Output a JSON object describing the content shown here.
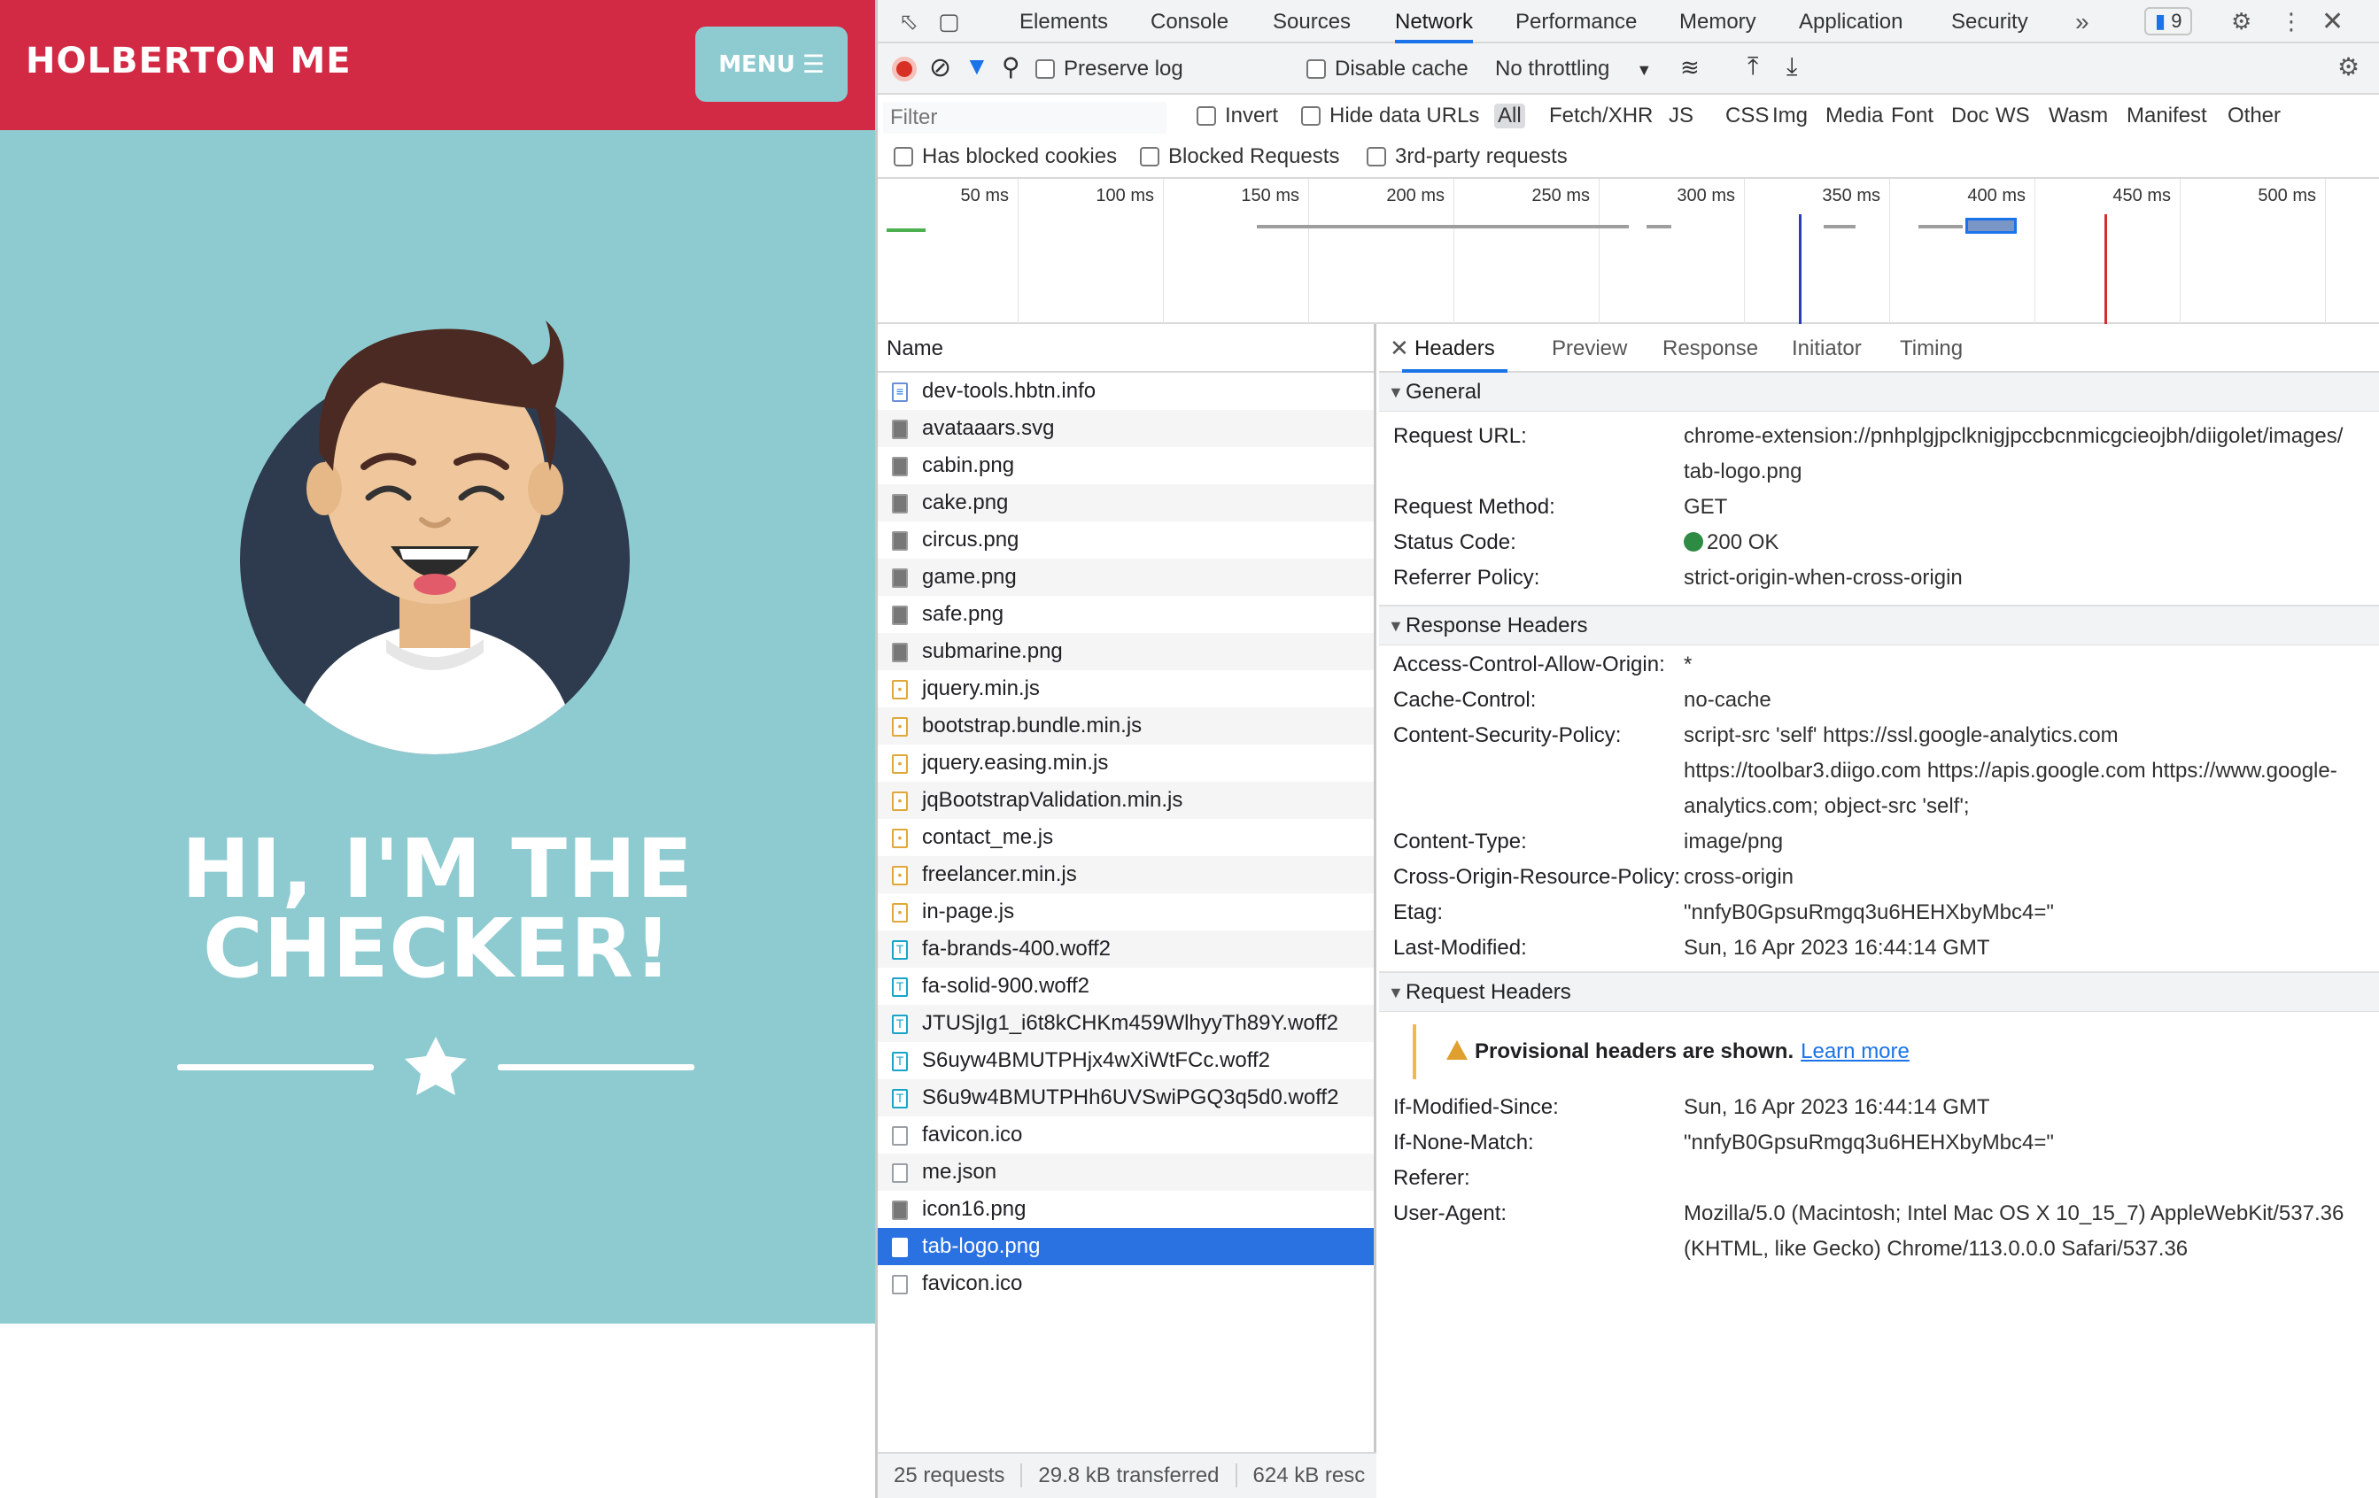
{
  "site": {
    "brand": "HOLBERTON ME",
    "menu_label": "MENU",
    "hero_title_line1": "HI, I'M THE",
    "hero_title_line2": "CHECKER!",
    "colors": {
      "nav": "#d22a44",
      "hero": "#8ecbd1"
    }
  },
  "devtools": {
    "tabs": [
      "Elements",
      "Console",
      "Sources",
      "Network",
      "Performance",
      "Memory",
      "Application",
      "Security"
    ],
    "active_tab": "Network",
    "issues_count": "9",
    "toolbar": {
      "preserve_log": "Preserve log",
      "disable_cache": "Disable cache",
      "throttling": "No throttling"
    },
    "filter": {
      "placeholder": "Filter",
      "invert": "Invert",
      "hide_data_urls": "Hide data URLs",
      "types": [
        "All",
        "Fetch/XHR",
        "JS",
        "CSS",
        "Img",
        "Media",
        "Font",
        "Doc",
        "WS",
        "Wasm",
        "Manifest",
        "Other"
      ],
      "has_blocked_cookies": "Has blocked cookies",
      "blocked_requests": "Blocked Requests",
      "third_party": "3rd-party requests"
    },
    "timeline_ticks": [
      "50 ms",
      "100 ms",
      "150 ms",
      "200 ms",
      "250 ms",
      "300 ms",
      "350 ms",
      "400 ms",
      "450 ms",
      "500 ms"
    ],
    "list_header": "Name",
    "requests": [
      {
        "name": "dev-tools.hbtn.info",
        "type": "doc"
      },
      {
        "name": "avataaars.svg",
        "type": "img"
      },
      {
        "name": "cabin.png",
        "type": "img"
      },
      {
        "name": "cake.png",
        "type": "img"
      },
      {
        "name": "circus.png",
        "type": "img"
      },
      {
        "name": "game.png",
        "type": "img"
      },
      {
        "name": "safe.png",
        "type": "img"
      },
      {
        "name": "submarine.png",
        "type": "img"
      },
      {
        "name": "jquery.min.js",
        "type": "js"
      },
      {
        "name": "bootstrap.bundle.min.js",
        "type": "js"
      },
      {
        "name": "jquery.easing.min.js",
        "type": "js"
      },
      {
        "name": "jqBootstrapValidation.min.js",
        "type": "js"
      },
      {
        "name": "contact_me.js",
        "type": "js"
      },
      {
        "name": "freelancer.min.js",
        "type": "js"
      },
      {
        "name": "in-page.js",
        "type": "js"
      },
      {
        "name": "fa-brands-400.woff2",
        "type": "font"
      },
      {
        "name": "fa-solid-900.woff2",
        "type": "font"
      },
      {
        "name": "JTUSjIg1_i6t8kCHKm459WlhyyTh89Y.woff2",
        "type": "font"
      },
      {
        "name": "S6uyw4BMUTPHjx4wXiWtFCc.woff2",
        "type": "font"
      },
      {
        "name": "S6u9w4BMUTPHh6UVSwiPGQ3q5d0.woff2",
        "type": "font"
      },
      {
        "name": "favicon.ico",
        "type": "other"
      },
      {
        "name": "me.json",
        "type": "other"
      },
      {
        "name": "icon16.png",
        "type": "img"
      },
      {
        "name": "tab-logo.png",
        "type": "other",
        "selected": true
      },
      {
        "name": "favicon.ico",
        "type": "other"
      }
    ],
    "status": {
      "requests": "25 requests",
      "transferred": "29.8 kB transferred",
      "resources": "624 kB resc"
    },
    "detail_tabs": [
      "Headers",
      "Preview",
      "Response",
      "Initiator",
      "Timing"
    ],
    "general_title": "General",
    "general": [
      {
        "k": "Request URL:",
        "v": "chrome-extension://pnhplgjpclknigjpccbcnmicgcieojbh/diigolet/images/ tab-logo.png"
      },
      {
        "k": "Request Method:",
        "v": "GET"
      },
      {
        "k": "Status Code:",
        "v": "200 OK",
        "status": true
      },
      {
        "k": "Referrer Policy:",
        "v": "strict-origin-when-cross-origin"
      }
    ],
    "response_title": "Response Headers",
    "response_headers": [
      {
        "k": "Access-Control-Allow-Origin:",
        "v": "*"
      },
      {
        "k": "Cache-Control:",
        "v": "no-cache"
      },
      {
        "k": "Content-Security-Policy:",
        "v": "script-src 'self' https://ssl.google-analytics.com https://toolbar3.diigo.com https://apis.google.com https://www.google-analytics.com; object-src 'self';"
      },
      {
        "k": "Content-Type:",
        "v": "image/png"
      },
      {
        "k": "Cross-Origin-Resource-Policy:",
        "v": "cross-origin"
      },
      {
        "k": "Etag:",
        "v": "\"nnfyB0GpsuRmgq3u6HEHXbyMbc4=\""
      },
      {
        "k": "Last-Modified:",
        "v": "Sun, 16 Apr 2023 16:44:14 GMT"
      }
    ],
    "request_title": "Request Headers",
    "provisional_text": "Provisional headers are shown.",
    "learn_more": "Learn more",
    "request_headers": [
      {
        "k": "If-Modified-Since:",
        "v": "Sun, 16 Apr 2023 16:44:14 GMT"
      },
      {
        "k": "If-None-Match:",
        "v": "\"nnfyB0GpsuRmgq3u6HEHXbyMbc4=\""
      },
      {
        "k": "Referer:",
        "v": ""
      },
      {
        "k": "User-Agent:",
        "v": "Mozilla/5.0 (Macintosh; Intel Mac OS X 10_15_7) AppleWebKit/537.36 (KHTML, like Gecko) Chrome/113.0.0.0 Safari/537.36"
      }
    ]
  }
}
